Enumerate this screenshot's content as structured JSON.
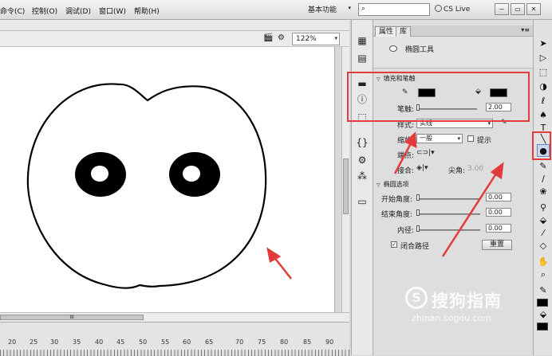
{
  "menubar": {
    "items": [
      "命令(C)",
      "控制(O)",
      "调试(D)",
      "窗口(W)",
      "帮助(H)"
    ],
    "workspace": "基本功能",
    "cs_live": "CS Live",
    "window_buttons": [
      "−",
      "▭",
      "✕"
    ]
  },
  "stage": {
    "zoom": "122%",
    "ruler_numbers": [
      "20",
      "25",
      "30",
      "35",
      "40",
      "45",
      "50",
      "55",
      "60",
      "65",
      "70",
      "75",
      "80",
      "85",
      "90"
    ],
    "hscroll_thumb_label": "III"
  },
  "properties": {
    "tabs": [
      "属性",
      "库"
    ],
    "panel_menu": "▾≡",
    "tool_name": "椭圆工具",
    "fill_stroke": {
      "header": "填充和笔触",
      "stroke_color": "#000000",
      "fill_color": "#000000",
      "stroke_width_label": "笔触:",
      "stroke_width_value": "2.00",
      "style_label": "样式:",
      "style_value": "实线",
      "scale_label": "缩放:",
      "scale_value": "一般",
      "hint_label": "提示",
      "cap_label": "端点:",
      "join_label": "接合:",
      "miter_label": "尖角:",
      "miter_value": "3.00"
    },
    "ellipse_options": {
      "header": "椭圆选项",
      "start_angle_label": "开始角度:",
      "start_angle_value": "0.00",
      "end_angle_label": "结束角度:",
      "end_angle_value": "0.00",
      "inner_radius_label": "内径:",
      "inner_radius_value": "0.00",
      "close_path_label": "闭合路径",
      "close_path_checked": true,
      "reset_label": "重置"
    }
  },
  "toolbox": {
    "tools": [
      "selection-tool",
      "subselection-tool",
      "free-transform-tool",
      "3d-rotation-tool",
      "lasso-tool",
      "pen-tool",
      "text-tool",
      "line-tool",
      "oval-tool",
      "pencil-tool",
      "brush-tool",
      "deco-tool",
      "bone-tool",
      "paint-bucket-tool",
      "eyedropper-tool",
      "eraser-tool",
      "hand-tool",
      "zoom-tool",
      "stroke-color",
      "fill-color"
    ]
  },
  "watermark": {
    "logo": "S",
    "text": "搜狗指南",
    "url": "zhinan.sogou.com"
  },
  "colors": {
    "highlight": "#e23b3b",
    "stroke": "#000000",
    "fill": "#000000"
  }
}
